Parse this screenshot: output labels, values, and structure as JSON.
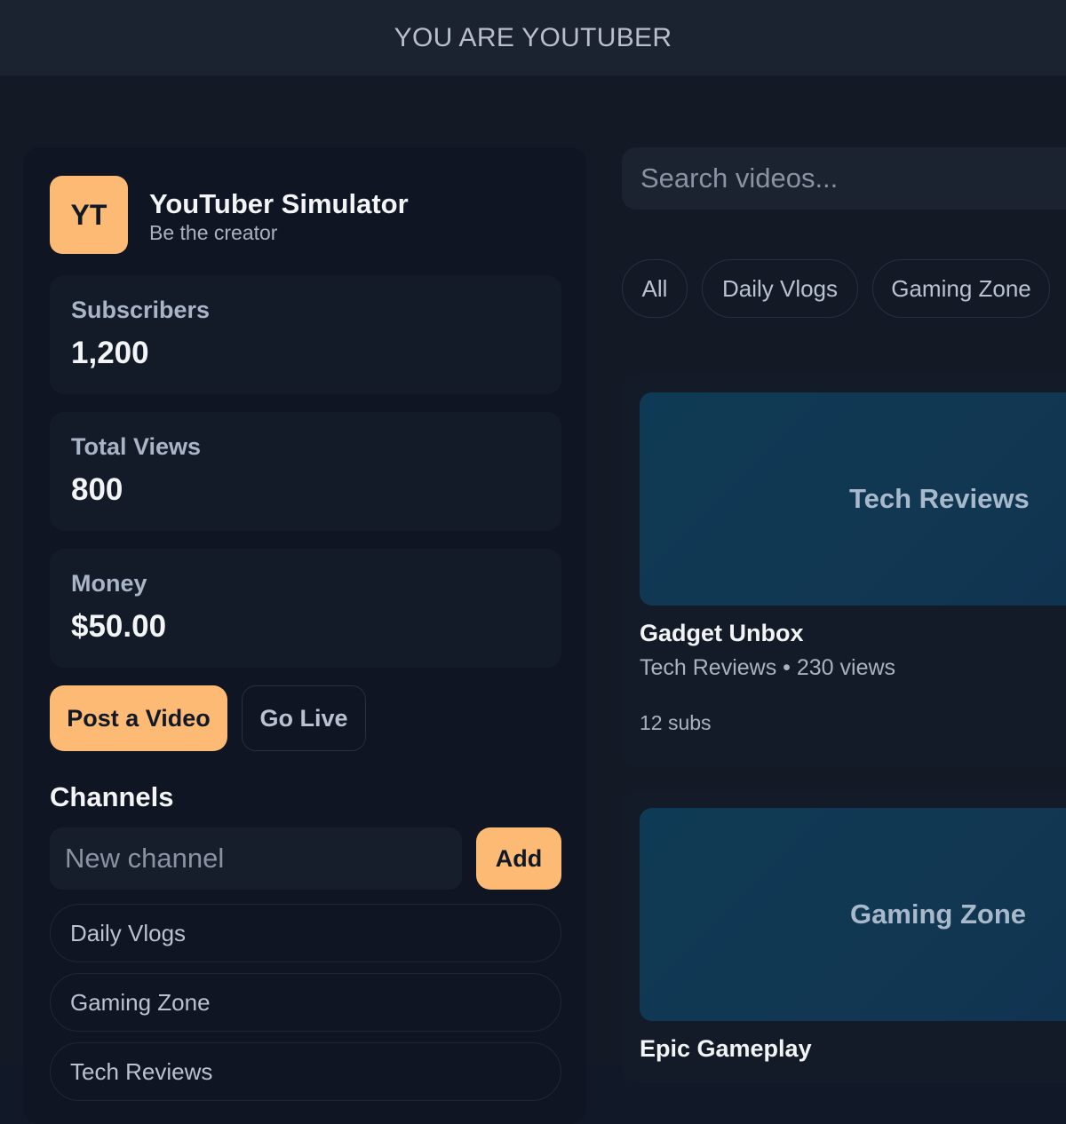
{
  "header": {
    "title": "YOU ARE YOUTUBER"
  },
  "brand": {
    "logo_text": "YT",
    "name": "YouTuber Simulator",
    "tagline": "Be the creator"
  },
  "stats": [
    {
      "label": "Subscribers",
      "value": "1,200"
    },
    {
      "label": "Total Views",
      "value": "800"
    },
    {
      "label": "Money",
      "value": "$50.00"
    }
  ],
  "actions": {
    "post_label": "Post a Video",
    "live_label": "Go Live"
  },
  "channels": {
    "title": "Channels",
    "input_placeholder": "New channel",
    "add_label": "Add",
    "items": [
      "Daily Vlogs",
      "Gaming Zone",
      "Tech Reviews"
    ]
  },
  "search": {
    "placeholder": "Search videos..."
  },
  "filters": [
    "All",
    "Daily Vlogs",
    "Gaming Zone"
  ],
  "videos": [
    {
      "thumb_label": "Tech Reviews",
      "title": "Gadget Unbox",
      "meta": "Tech Reviews • 230 views",
      "subs": "12 subs"
    },
    {
      "thumb_label": "Gaming Zone",
      "title": "Epic Gameplay"
    }
  ],
  "colors": {
    "accent": "#fdba74",
    "background": "#111827",
    "panel": "#0f1522"
  }
}
